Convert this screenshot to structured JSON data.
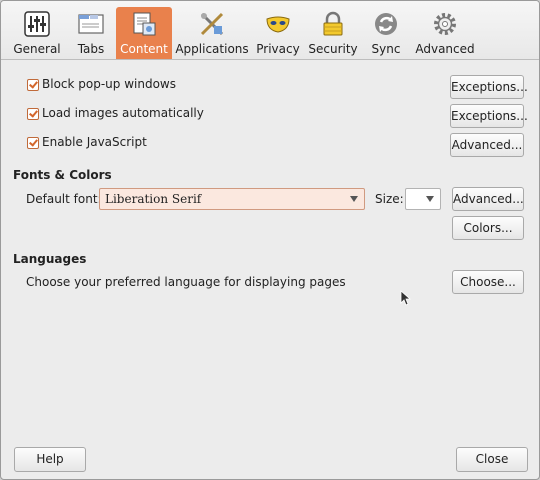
{
  "toolbar": {
    "tabs": [
      {
        "label": "General",
        "icon": "sliders-icon"
      },
      {
        "label": "Tabs",
        "icon": "window-tabs-icon"
      },
      {
        "label": "Content",
        "icon": "content-page-icon",
        "selected": true
      },
      {
        "label": "Applications",
        "icon": "applications-icon"
      },
      {
        "label": "Privacy",
        "icon": "mask-icon"
      },
      {
        "label": "Security",
        "icon": "lock-icon"
      },
      {
        "label": "Sync",
        "icon": "sync-icon"
      },
      {
        "label": "Advanced",
        "icon": "gear-icon"
      }
    ]
  },
  "content": {
    "block_popups": {
      "label": "Block pop-up windows",
      "checked": true,
      "button": "Exceptions..."
    },
    "load_images": {
      "label": "Load images automatically",
      "checked": true,
      "button": "Exceptions..."
    },
    "enable_js": {
      "label": "Enable JavaScript",
      "checked": true,
      "button": "Advanced..."
    }
  },
  "fonts": {
    "heading": "Fonts & Colors",
    "default_font_label": "Default font:",
    "default_font_value": "Liberation Serif",
    "size_label": "Size:",
    "size_value": "",
    "advanced_button": "Advanced...",
    "colors_button": "Colors..."
  },
  "languages": {
    "heading": "Languages",
    "description": "Choose your preferred language for displaying pages",
    "choose_button": "Choose..."
  },
  "footer": {
    "help_button": "Help",
    "close_button": "Close"
  },
  "colors": {
    "accent": "#e9814c",
    "selected_field": "#fbe8df"
  }
}
